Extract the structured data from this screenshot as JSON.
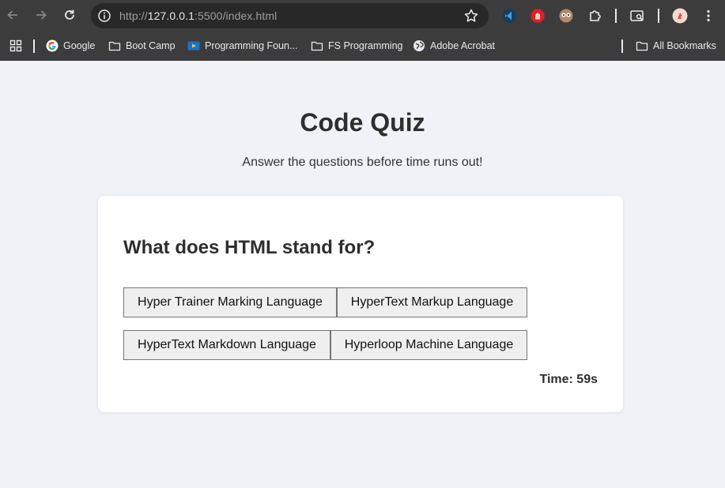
{
  "browser": {
    "url_scheme": "http://",
    "url_host": "127.0.0.1",
    "url_rest": ":5500/index.html"
  },
  "bookmarks": {
    "items": [
      {
        "label": "Google",
        "icon": "google-icon"
      },
      {
        "label": "Boot Camp",
        "icon": "folder-icon"
      },
      {
        "label": "Programming Foun...",
        "icon": "video-icon"
      },
      {
        "label": "FS Programming",
        "icon": "folder-icon"
      },
      {
        "label": "Adobe Acrobat",
        "icon": "globe-icon"
      }
    ],
    "all_bookmarks": "All Bookmarks"
  },
  "page": {
    "title": "Code Quiz",
    "subtitle": "Answer the questions before time runs out!"
  },
  "quiz": {
    "question": "What does HTML stand for?",
    "answers": [
      "Hyper Trainer Marking Language",
      "HyperText Markup Language",
      "HyperText Markdown Language",
      "Hyperloop Machine Language"
    ],
    "timer": "Time: 59s"
  },
  "colors": {
    "page_bg": "#eff2f6",
    "card_bg": "#ffffff",
    "chrome_bg": "#3c3c3c",
    "omnibox_bg": "#282828"
  }
}
